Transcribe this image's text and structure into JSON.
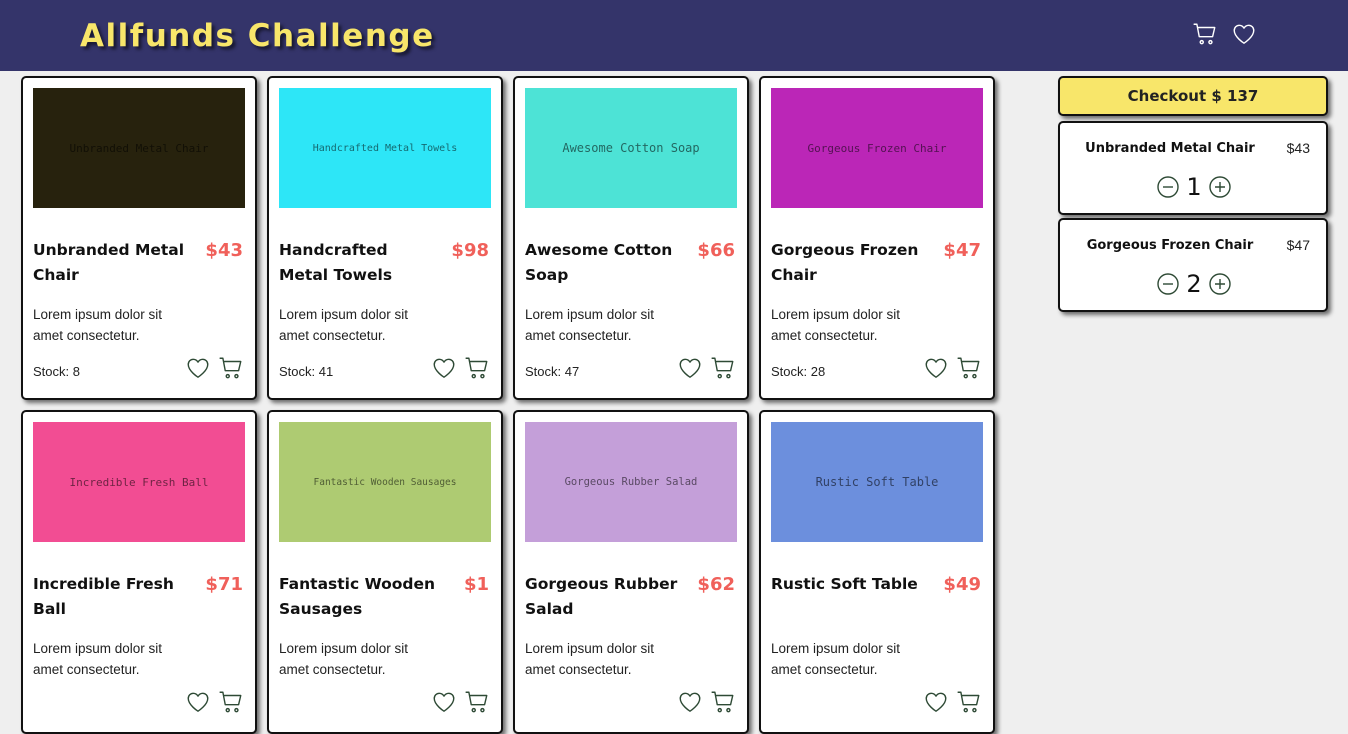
{
  "header": {
    "title": "Allfunds Challenge",
    "cart_icon": "cart-icon",
    "heart_icon": "heart-icon",
    "title_color": "#f8e66a",
    "bg_color": "#34346a"
  },
  "products": [
    {
      "image_label": "Unbranded Metal Chair",
      "image_color": "#27220d",
      "name": "Unbranded Metal Chair",
      "price": "$43",
      "description": "Lorem ipsum dolor sit amet consectetur.",
      "stock": "Stock: 8"
    },
    {
      "image_label": "Handcrafted Metal Towels",
      "image_color": "#2de6f7",
      "name": "Handcrafted Metal Towels",
      "price": "$98",
      "description": "Lorem ipsum dolor sit amet consectetur.",
      "stock": "Stock: 41"
    },
    {
      "image_label": "Awesome Cotton Soap",
      "image_color": "#4de3d6",
      "name": "Awesome Cotton Soap",
      "price": "$66",
      "description": "Lorem ipsum dolor sit amet consectetur.",
      "stock": "Stock: 47"
    },
    {
      "image_label": "Gorgeous Frozen Chair",
      "image_color": "#bb26b7",
      "name": "Gorgeous Frozen Chair",
      "price": "$47",
      "description": "Lorem ipsum dolor sit amet consectetur.",
      "stock": "Stock: 28"
    },
    {
      "image_label": "Incredible Fresh Ball",
      "image_color": "#f24d93",
      "name": "Incredible Fresh Ball",
      "price": "$71",
      "description": "Lorem ipsum dolor sit amet consectetur.",
      "stock": ""
    },
    {
      "image_label": "Fantastic Wooden Sausages",
      "image_color": "#aecb72",
      "name": "Fantastic Wooden Sausages",
      "price": "$1",
      "description": "Lorem ipsum dolor sit amet consectetur.",
      "stock": ""
    },
    {
      "image_label": "Gorgeous Rubber Salad",
      "image_color": "#c49fd9",
      "name": "Gorgeous Rubber Salad",
      "price": "$62",
      "description": "Lorem ipsum dolor sit amet consectetur.",
      "stock": ""
    },
    {
      "image_label": "Rustic Soft Table",
      "image_color": "#6c8fdd",
      "name": "Rustic Soft Table",
      "price": "$49",
      "description": "Lorem ipsum dolor sit amet consectetur.",
      "stock": ""
    }
  ],
  "cart": {
    "checkout_label": "Checkout $ 137",
    "checkout_color": "#f8e66a",
    "items": [
      {
        "name": "Unbranded Metal Chair",
        "price": "$43",
        "quantity": "1"
      },
      {
        "name": "Gorgeous Frozen Chair",
        "price": "$47",
        "quantity": "2"
      }
    ]
  },
  "accent_price_color": "#f0605a",
  "icon_color": "#2e4a35"
}
